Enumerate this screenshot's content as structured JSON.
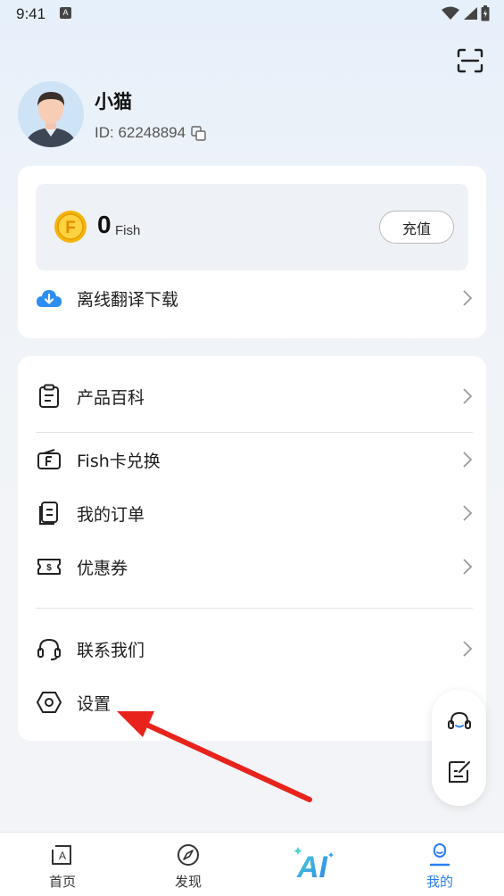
{
  "status_bar": {
    "time": "9:41"
  },
  "profile": {
    "name": "小猫",
    "id_text": "ID: 62248894"
  },
  "wallet": {
    "amount": "0",
    "unit": "Fish",
    "recharge_label": "充值",
    "coin_letter": "F"
  },
  "card1_items": [
    {
      "label": "离线翻译下载",
      "icon": "cloud-download-icon"
    }
  ],
  "card2_items": [
    {
      "label": "产品百科",
      "icon": "clipboard-icon"
    },
    {
      "label": "Fish卡兑换",
      "icon": "fish-card-icon"
    },
    {
      "label": "我的订单",
      "icon": "order-icon"
    },
    {
      "label": "优惠券",
      "icon": "coupon-icon"
    },
    {
      "label": "联系我们",
      "icon": "headset-icon"
    },
    {
      "label": "设置",
      "icon": "settings-hexagon-icon"
    }
  ],
  "bottom_nav": [
    {
      "label": "首页",
      "icon": "home-icon",
      "active": false
    },
    {
      "label": "发现",
      "icon": "compass-icon",
      "active": false
    },
    {
      "label": "AI",
      "icon": "ai-logo-icon",
      "active": false
    },
    {
      "label": "我的",
      "icon": "profile-icon",
      "active": true
    }
  ],
  "colors": {
    "accent": "#2a7df1",
    "arrow": "#e8231c",
    "coin": "#f5b40a"
  }
}
